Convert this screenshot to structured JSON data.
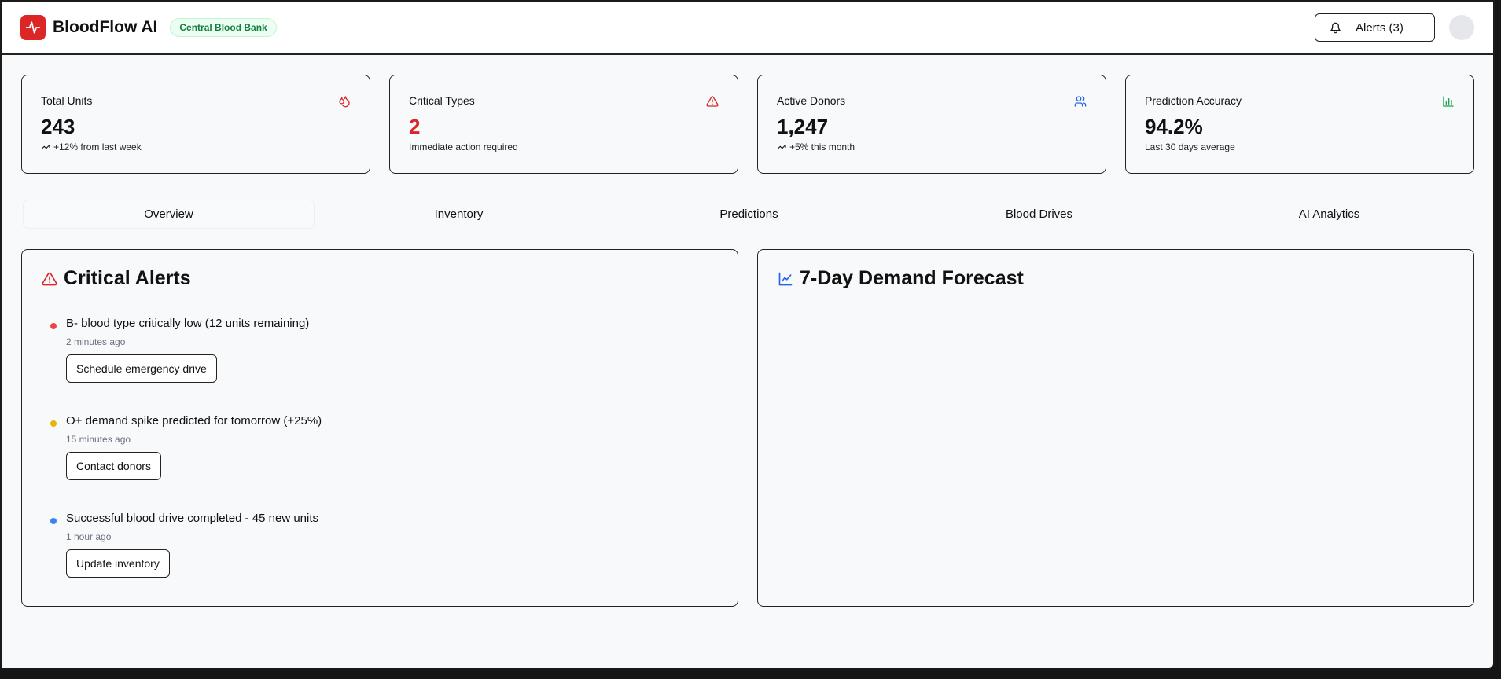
{
  "header": {
    "brand": "BloodFlow AI",
    "badge": "Central Blood Bank",
    "alerts_label": "Alerts (3)"
  },
  "stats": [
    {
      "title": "Total Units",
      "value": "243",
      "sub": "+12% from last week",
      "icon": "droplets-icon"
    },
    {
      "title": "Critical Types",
      "value": "2",
      "sub": "Immediate action required",
      "icon": "alert-triangle-icon"
    },
    {
      "title": "Active Donors",
      "value": "1,247",
      "sub": "+5% this month",
      "icon": "users-icon"
    },
    {
      "title": "Prediction Accuracy",
      "value": "94.2%",
      "sub": "Last 30 days average",
      "icon": "bar-chart-icon"
    }
  ],
  "tabs": [
    "Overview",
    "Inventory",
    "Predictions",
    "Blood Drives",
    "AI Analytics"
  ],
  "active_tab": "Overview",
  "alerts_panel": {
    "title": "Critical Alerts",
    "items": [
      {
        "message": "B- blood type critically low (12 units remaining)",
        "time": "2 minutes ago",
        "action": "Schedule emergency drive",
        "color": "#ef4444"
      },
      {
        "message": "O+ demand spike predicted for tomorrow (+25%)",
        "time": "15 minutes ago",
        "action": "Contact donors",
        "color": "#eab308"
      },
      {
        "message": "Successful blood drive completed - 45 new units",
        "time": "1 hour ago",
        "action": "Update inventory",
        "color": "#3b82f6"
      }
    ]
  },
  "forecast_panel": {
    "title": "7-Day Demand Forecast"
  },
  "colors": {
    "brand": "#dc2626",
    "critical": "#dc2626",
    "donors": "#2563eb",
    "accuracy": "#16a34a"
  }
}
